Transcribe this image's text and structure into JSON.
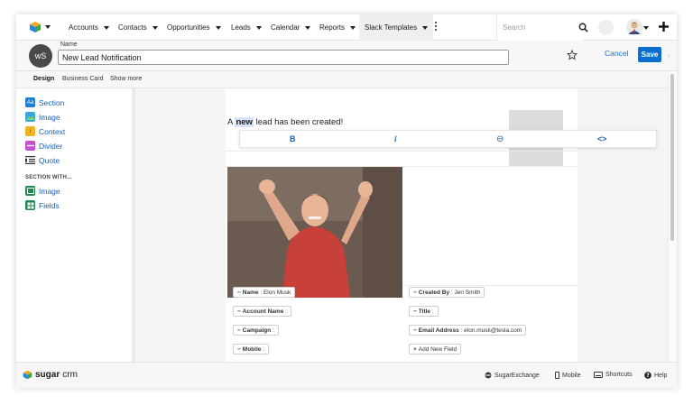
{
  "nav": {
    "items": [
      {
        "label": "Accounts"
      },
      {
        "label": "Contacts"
      },
      {
        "label": "Opportunities"
      },
      {
        "label": "Leads"
      },
      {
        "label": "Calendar"
      },
      {
        "label": "Reports"
      },
      {
        "label": "Slack Templates"
      }
    ],
    "search_placeholder": "Search"
  },
  "header": {
    "avatar_initials": "wS",
    "name_label": "Name",
    "name_value": "New Lead Notification",
    "cancel_label": "Cancel",
    "save_label": "Save"
  },
  "tabs": [
    {
      "label": "Design"
    },
    {
      "label": "Business Card"
    },
    {
      "label": "Show more"
    }
  ],
  "palette": {
    "items": [
      {
        "label": "Section",
        "icon": "aa-icon",
        "color": "#1e7fd6"
      },
      {
        "label": "Image",
        "icon": "image-icon",
        "color": "#3aa6e0"
      },
      {
        "label": "Context",
        "icon": "info-icon",
        "color": "#f0b323"
      },
      {
        "label": "Divider",
        "icon": "divider-icon",
        "color": "#c84fd0"
      },
      {
        "label": "Quote",
        "icon": "quote-icon",
        "color": "#333333"
      }
    ],
    "section_heading": "SECTION WITH...",
    "section_items": [
      {
        "label": "Image",
        "icon": "image-icon",
        "color": "#1f8a50"
      },
      {
        "label": "Fields",
        "icon": "fields-icon",
        "color": "#1f8a50"
      }
    ]
  },
  "canvas": {
    "headline_prefix": "A ",
    "headline_bold": "new",
    "headline_suffix": " lead has been created!",
    "toolbar": {
      "bold": "B",
      "italic": "i",
      "link": "⊖",
      "code": "<>"
    },
    "fields_left": [
      {
        "label": "Name",
        "value": "Elon Musk"
      },
      {
        "label": "Account Name",
        "value": ""
      },
      {
        "label": "Campaign",
        "value": ""
      },
      {
        "label": "Mobile",
        "value": ""
      }
    ],
    "fields_right": [
      {
        "label": "Created By",
        "value": "Jen Smith"
      },
      {
        "label": "Title",
        "value": ""
      },
      {
        "label": "Email Address",
        "value": "elon.musk@tesla.com"
      }
    ],
    "add_field_label": "Add New Field"
  },
  "footer": {
    "brand_sugar": "sugar",
    "brand_crm": "crm",
    "links": [
      {
        "label": "SugarExchange"
      },
      {
        "label": "Mobile"
      },
      {
        "label": "Shortcuts"
      },
      {
        "label": "Help"
      }
    ]
  },
  "colors": {
    "accent": "#0b6fd1",
    "link": "#1a5fb0"
  }
}
